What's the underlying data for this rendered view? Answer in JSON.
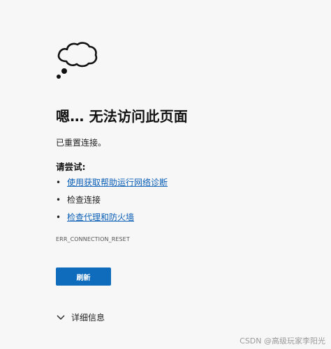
{
  "page": {
    "icon": "thought-cloud-icon",
    "title": "嗯… 无法访问此页面",
    "subtitle": "已重置连接。",
    "try_heading": "请尝试:",
    "suggestions": [
      {
        "label": "使用获取帮助运行网络诊断",
        "link": true
      },
      {
        "label": "检查连接",
        "link": false
      },
      {
        "label": "检查代理和防火墙",
        "link": true
      }
    ],
    "error_code": "ERR_CONNECTION_RESET",
    "refresh_label": "刷新",
    "details_label": "详细信息"
  },
  "watermark": "CSDN @高级玩家李阳光",
  "colors": {
    "background": "#f7f7f7",
    "accent": "#0f6cbd",
    "link": "#0b5fb7"
  }
}
